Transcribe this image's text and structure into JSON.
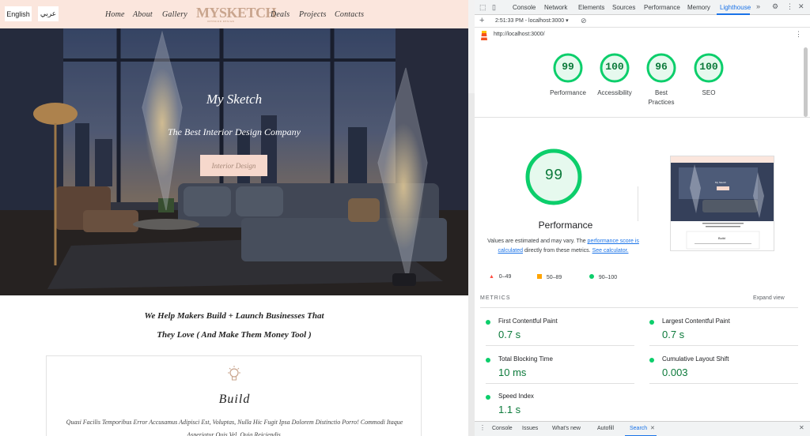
{
  "site": {
    "lang_en": "English",
    "lang_ar": "عربي",
    "nav": [
      "Home",
      "About",
      "Gallery",
      "Deals",
      "Projects",
      "Contacts"
    ],
    "logo": "MYSKETCH",
    "logo_sub": "INTERIOR DESIGN",
    "hero_title": "My Sketch",
    "hero_subtitle": "The Best Interior Design Company",
    "hero_button": "Interior Design",
    "help_line1": "We Help Makers Build + Launch Businesses That",
    "help_line2": "They Love ( And Make Them Money Tool )",
    "card_title": "Build",
    "card_text": "Quasi Facilis Temporibus Error Accusamus Adipisci Est, Voluptas, Nulla Hic Fugit Ipsa Dolorem Distinctio Porro! Commodi Itaque Asperiatur Quis Vel, Quia Reiciendis."
  },
  "devtools": {
    "tabs": [
      "Console",
      "Network",
      "Elements",
      "Sources",
      "Performance",
      "Memory",
      "Lighthouse"
    ],
    "active_tab": "Lighthouse",
    "more_tabs": "»",
    "report_select": "2:51:33 PM - localhost:3000 ▾",
    "url": "http://localhost:3000/",
    "scores": [
      {
        "label": "Performance",
        "value": "99"
      },
      {
        "label": "Accessibility",
        "value": "100"
      },
      {
        "label": "Best Practices",
        "value": "96"
      },
      {
        "label": "SEO",
        "value": "100"
      }
    ],
    "big_score": "99",
    "perf_title": "Performance",
    "perf_desc_1": "Values are estimated and may vary. The ",
    "perf_desc_link1": "performance score is calculated",
    "perf_desc_2": " directly from these metrics. ",
    "perf_desc_link2": "See calculator.",
    "legend": [
      {
        "range": "0–49",
        "color": "#ff4e42"
      },
      {
        "range": "50–89",
        "color": "#ffa400"
      },
      {
        "range": "90–100",
        "color": "#0cce6b"
      }
    ],
    "metrics_label": "METRICS",
    "expand_view": "Expand view",
    "metrics": [
      {
        "name": "First Contentful Paint",
        "value": "0.7 s"
      },
      {
        "name": "Largest Contentful Paint",
        "value": "0.7 s"
      },
      {
        "name": "Total Blocking Time",
        "value": "10 ms"
      },
      {
        "name": "Cumulative Layout Shift",
        "value": "0.003"
      },
      {
        "name": "Speed Index",
        "value": "1.1 s"
      }
    ],
    "drawer_tabs": [
      "Console",
      "Issues",
      "What's new",
      "Autofill",
      "Search"
    ],
    "active_drawer_tab": "Search",
    "thumb_title": "My Sketch",
    "thumb_card": "Build",
    "colors": {
      "good": "#0cce6b",
      "good_text": "#0c7a3b",
      "accent": "#1a73e8",
      "nav_bg": "#fbe6dd"
    }
  }
}
